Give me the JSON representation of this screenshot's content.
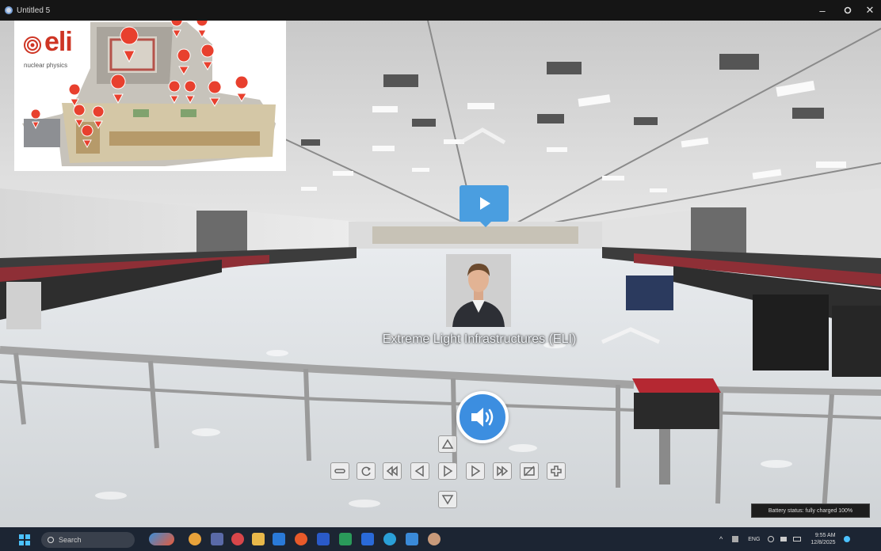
{
  "window": {
    "title": "Untitled 5"
  },
  "tour": {
    "logo_text": "eli",
    "logo_subtitle": "nuclear physics",
    "caption": "Extreme Light Infrastructures (ELI)"
  },
  "controls": [
    "zoom-out",
    "rotate",
    "rewind",
    "step-back",
    "play",
    "step-forward",
    "fast-forward",
    "hide-hotspots",
    "zoom-in",
    "up",
    "down"
  ],
  "status": {
    "battery_tooltip": "Battery status: fully charged 100%"
  },
  "taskbar": {
    "search_placeholder": "Search",
    "language": "ENG",
    "time": "9:55 AM",
    "date": "12/8/2025"
  },
  "colors": {
    "accent": "#3c8ee0",
    "marker": "#e8402e",
    "taskbar": "#1c2533"
  }
}
